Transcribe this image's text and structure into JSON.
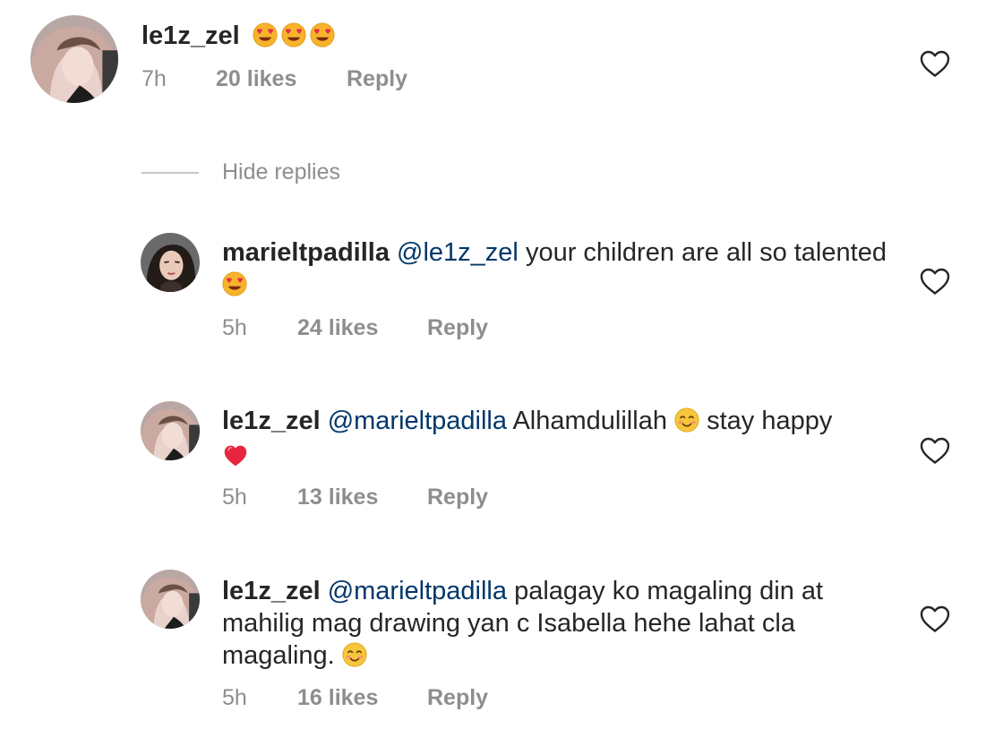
{
  "comments": [
    {
      "username": "le1z_zel",
      "mention": "",
      "text": "",
      "emojis": [
        "heart-eyes-emoji",
        "heart-eyes-emoji",
        "heart-eyes-emoji"
      ],
      "time": "7h",
      "likes": "20 likes",
      "reply": "Reply"
    }
  ],
  "hide_replies": "Hide replies",
  "replies": [
    {
      "username": "marieltpadilla",
      "mention": "@le1z_zel",
      "text_line1": "your children are all so talented",
      "text_line2": "",
      "text_line3": "",
      "trailing_emoji": "heart-eyes-emoji",
      "time": "5h",
      "likes": "24 likes",
      "reply": "Reply"
    },
    {
      "username": "le1z_zel",
      "mention": "@marieltpadilla",
      "text_a": "Alhamdulillah",
      "text_b": "stay happy",
      "inline_emoji": "smiling-blush-emoji",
      "trailing_emoji": "red-heart-emoji",
      "time": "5h",
      "likes": "13 likes",
      "reply": "Reply"
    },
    {
      "username": "le1z_zel",
      "mention": "@marieltpadilla",
      "text_line1": "palagay ko magaling din  at",
      "text_line2": "mahilig mag drawing yan c Isabella hehe lahat cla",
      "text_line3": "magaling.",
      "trailing_emoji": "smiling-blush-emoji",
      "time": "5h",
      "likes": "16 likes",
      "reply": "Reply"
    }
  ],
  "colors": {
    "text": "#262626",
    "meta": "#8e8e8e",
    "mention": "#00376b",
    "divider": "#c7c7c7"
  }
}
